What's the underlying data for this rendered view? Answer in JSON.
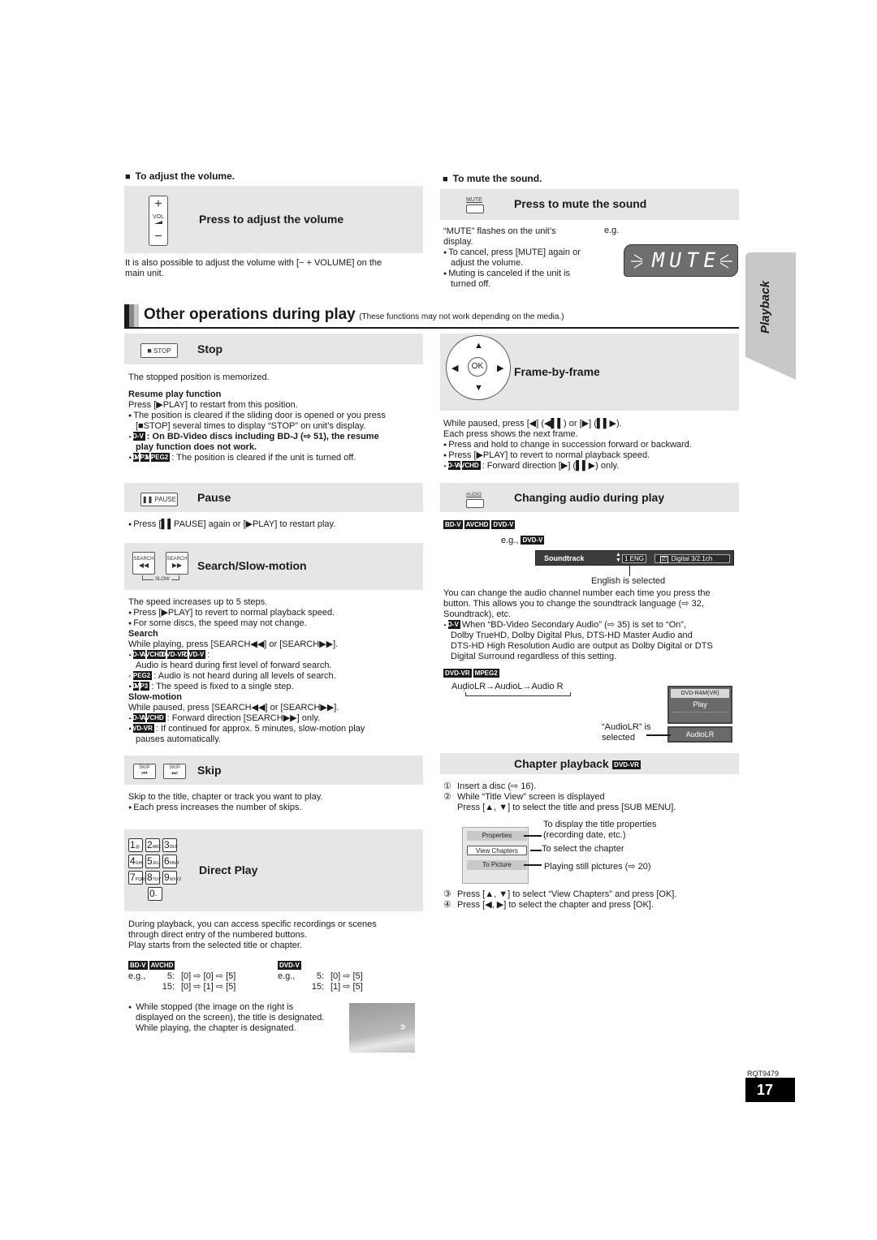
{
  "volume": {
    "heading": "To adjust the volume.",
    "box_title": "Press to adjust the volume",
    "button_label": "VOL",
    "plus": "+",
    "minus": "−",
    "note_lines": [
      "It is also possible to adjust the volume with [− + VOLUME] on the",
      "main unit."
    ]
  },
  "mute": {
    "heading": "To mute the sound.",
    "box_title": "Press to mute the sound",
    "button_label": "MUTE",
    "desc_lines": [
      "“MUTE” flashes on the unit’s",
      "display."
    ],
    "eg": "e.g.",
    "bullets": [
      [
        "To cancel, press [MUTE] again or",
        "adjust the volume."
      ],
      [
        "Muting is canceled if the unit is",
        "turned off."
      ]
    ],
    "display_text": "MUTE"
  },
  "section": {
    "title": "Other operations during play",
    "subtitle": "(These functions may not work depending on the media.)",
    "side_tab": "Playback"
  },
  "stop": {
    "button_label": "STOP",
    "title": "Stop",
    "desc": "The stopped position is memorized.",
    "resume_heading": "Resume play function",
    "resume_line": "Press [▶PLAY] to restart from this position.",
    "bullet1_lines": [
      "The position is cleared if the sliding door is opened or you press",
      "[■STOP] several times to display “STOP” on unit’s display."
    ],
    "bullet2_tag": "BD-V",
    "bullet2_lines": [
      ": On BD-Video discs including BD-J (⇨ 51), the resume",
      "play function does not work."
    ],
    "bullet3_tags": [
      "CD",
      "MP3",
      "MPEG2"
    ],
    "bullet3_text": ": The position is cleared if the unit is turned off."
  },
  "frame": {
    "title": "Frame-by-frame",
    "ok_label": "OK",
    "lines": [
      "While paused, press [◀] (◀▌▌) or [▶] (▌▌▶).",
      "Each press shows the next frame."
    ],
    "bullets": [
      "Press and hold to change in succession forward or backward.",
      "Press [▶PLAY] to revert to normal playback speed."
    ],
    "bullet3_tags": [
      "BD-V",
      "AVCHD"
    ],
    "bullet3_text": ": Forward direction [▶] (▌▌▶) only."
  },
  "pause": {
    "button_label": "PAUSE",
    "title": "Pause",
    "bullet": "Press [▌▌PAUSE] again or [▶PLAY] to restart play."
  },
  "search": {
    "button_label": "SEARCH",
    "slow_label": "SLOW",
    "title": "Search/Slow-motion",
    "desc": "The speed increases up to 5 steps.",
    "bullets": [
      "Press [▶PLAY] to revert to normal playback speed.",
      "For some discs, the speed may not change."
    ],
    "search_heading": "Search",
    "search_line": "While playing, press [SEARCH◀◀] or [SEARCH▶▶].",
    "search_b1_tags": [
      "BD-V",
      "AVCHD",
      "DVD-VR",
      "DVD-V"
    ],
    "search_b1_text": ":",
    "search_b1_line2": "Audio is heard during first level of forward search.",
    "search_b2_tags": [
      "MPEG2"
    ],
    "search_b2_text": ": Audio is not heard during all levels of search.",
    "search_b3_tags": [
      "CD",
      "MP3"
    ],
    "search_b3_text": ": The speed is fixed to a single step.",
    "slow_heading": "Slow-motion",
    "slow_line": "While paused, press [SEARCH◀◀] or [SEARCH▶▶].",
    "slow_b1_tags": [
      "BD-V",
      "AVCHD"
    ],
    "slow_b1_text": ": Forward direction [SEARCH▶▶] only.",
    "slow_b2_tags": [
      "DVD-VR"
    ],
    "slow_b2_text": ": If continued for approx. 5 minutes, slow-motion play",
    "slow_b2_line2": "pauses automatically."
  },
  "skip": {
    "button_label": "SKIP",
    "title": "Skip",
    "desc": "Skip to the title, chapter or track you want to play.",
    "bullet": "Each press increases the number of skips."
  },
  "direct": {
    "title": "Direct Play",
    "keys": [
      {
        "n": "1",
        "s": "@."
      },
      {
        "n": "2",
        "s": "ABC"
      },
      {
        "n": "3",
        "s": "DEF"
      },
      {
        "n": "4",
        "s": "GHI"
      },
      {
        "n": "5",
        "s": "JKL"
      },
      {
        "n": "6",
        "s": "MNO"
      },
      {
        "n": "7",
        "s": "PQRS"
      },
      {
        "n": "8",
        "s": "TUV"
      },
      {
        "n": "9",
        "s": "WXYZ"
      },
      {
        "n": "0",
        "s": "–"
      }
    ],
    "desc_lines": [
      "During playback, you can access specific recordings or scenes",
      "through direct entry of the numbered buttons.",
      "Play starts from the selected title or chapter."
    ],
    "ex_left_tags": [
      "BD-V",
      "AVCHD"
    ],
    "ex_right_tags": [
      "DVD-V"
    ],
    "eg": "e.g.,",
    "ex_left": [
      {
        "num": "5:",
        "seq": "[0] ⇨ [0] ⇨ [5]"
      },
      {
        "num": "15:",
        "seq": "[0] ⇨ [1] ⇨ [5]"
      }
    ],
    "ex_right": [
      {
        "num": "5:",
        "seq": "[0] ⇨ [5]"
      },
      {
        "num": "15:",
        "seq": "[1] ⇨ [5]"
      }
    ],
    "bullet_lines": [
      "While stopped (the image on the right is",
      "displayed on the screen), the title is designated.",
      "While playing, the chapter is designated."
    ]
  },
  "audio": {
    "button_label": "AUDIO",
    "title": "Changing audio during play",
    "tags": [
      "BD-V",
      "AVCHD",
      "DVD-V"
    ],
    "eg": "e.g.,",
    "eg_tag": "DVD-V",
    "osd_label": "Soundtrack",
    "osd_value": "1 ENG",
    "osd_format": "Digital  3/2.1ch",
    "osd_caption": "English is selected",
    "desc_lines": [
      "You can change the audio channel number each time you press the",
      "button. This allows you to change the soundtrack language (⇨ 32,",
      "Soundtrack), etc."
    ],
    "bullet_tag": "BD-V",
    "bullet_lines": [
      "When “BD-Video Secondary Audio” (⇨ 35) is set to “On”,",
      "Dolby TrueHD, Dolby Digital Plus, DTS-HD Master Audio and",
      "DTS-HD High Resolution Audio are output as Dolby Digital or DTS",
      "Digital Surround regardless of this setting."
    ],
    "vr_tags": [
      "DVD-VR",
      "MPEG2"
    ],
    "cycle": "AudioLR→AudioL→Audio R",
    "vr_menu_header": "DVD-RAM(VR)",
    "vr_menu_play": "Play",
    "vr_menu_selected": "AudioLR",
    "vr_caption_lines": [
      "“AudioLR” is",
      "selected"
    ]
  },
  "chapter": {
    "title": "Chapter playback",
    "title_tag": "DVD-VR",
    "steps": [
      {
        "num": "①",
        "lines": [
          "Insert a disc (⇨ 16)."
        ]
      },
      {
        "num": "②",
        "lines": [
          "While “Title View” screen is displayed",
          "Press [▲, ▼] to select the title and press [SUB MENU]."
        ]
      }
    ],
    "menu_items": [
      "Properties",
      "View Chapters",
      "To Picture"
    ],
    "menu_notes": [
      [
        "To display the title properties",
        "(recording date, etc.)"
      ],
      [
        "To select the chapter"
      ],
      [
        "Playing still pictures (⇨ 20)"
      ]
    ],
    "steps_after": [
      {
        "num": "③",
        "text": "Press [▲, ▼] to select “View Chapters” and press [OK]."
      },
      {
        "num": "④",
        "text": "Press [◀, ▶] to select the chapter and press [OK]."
      }
    ]
  },
  "footer": {
    "model_code": "RQT9479",
    "page_number": "17"
  }
}
